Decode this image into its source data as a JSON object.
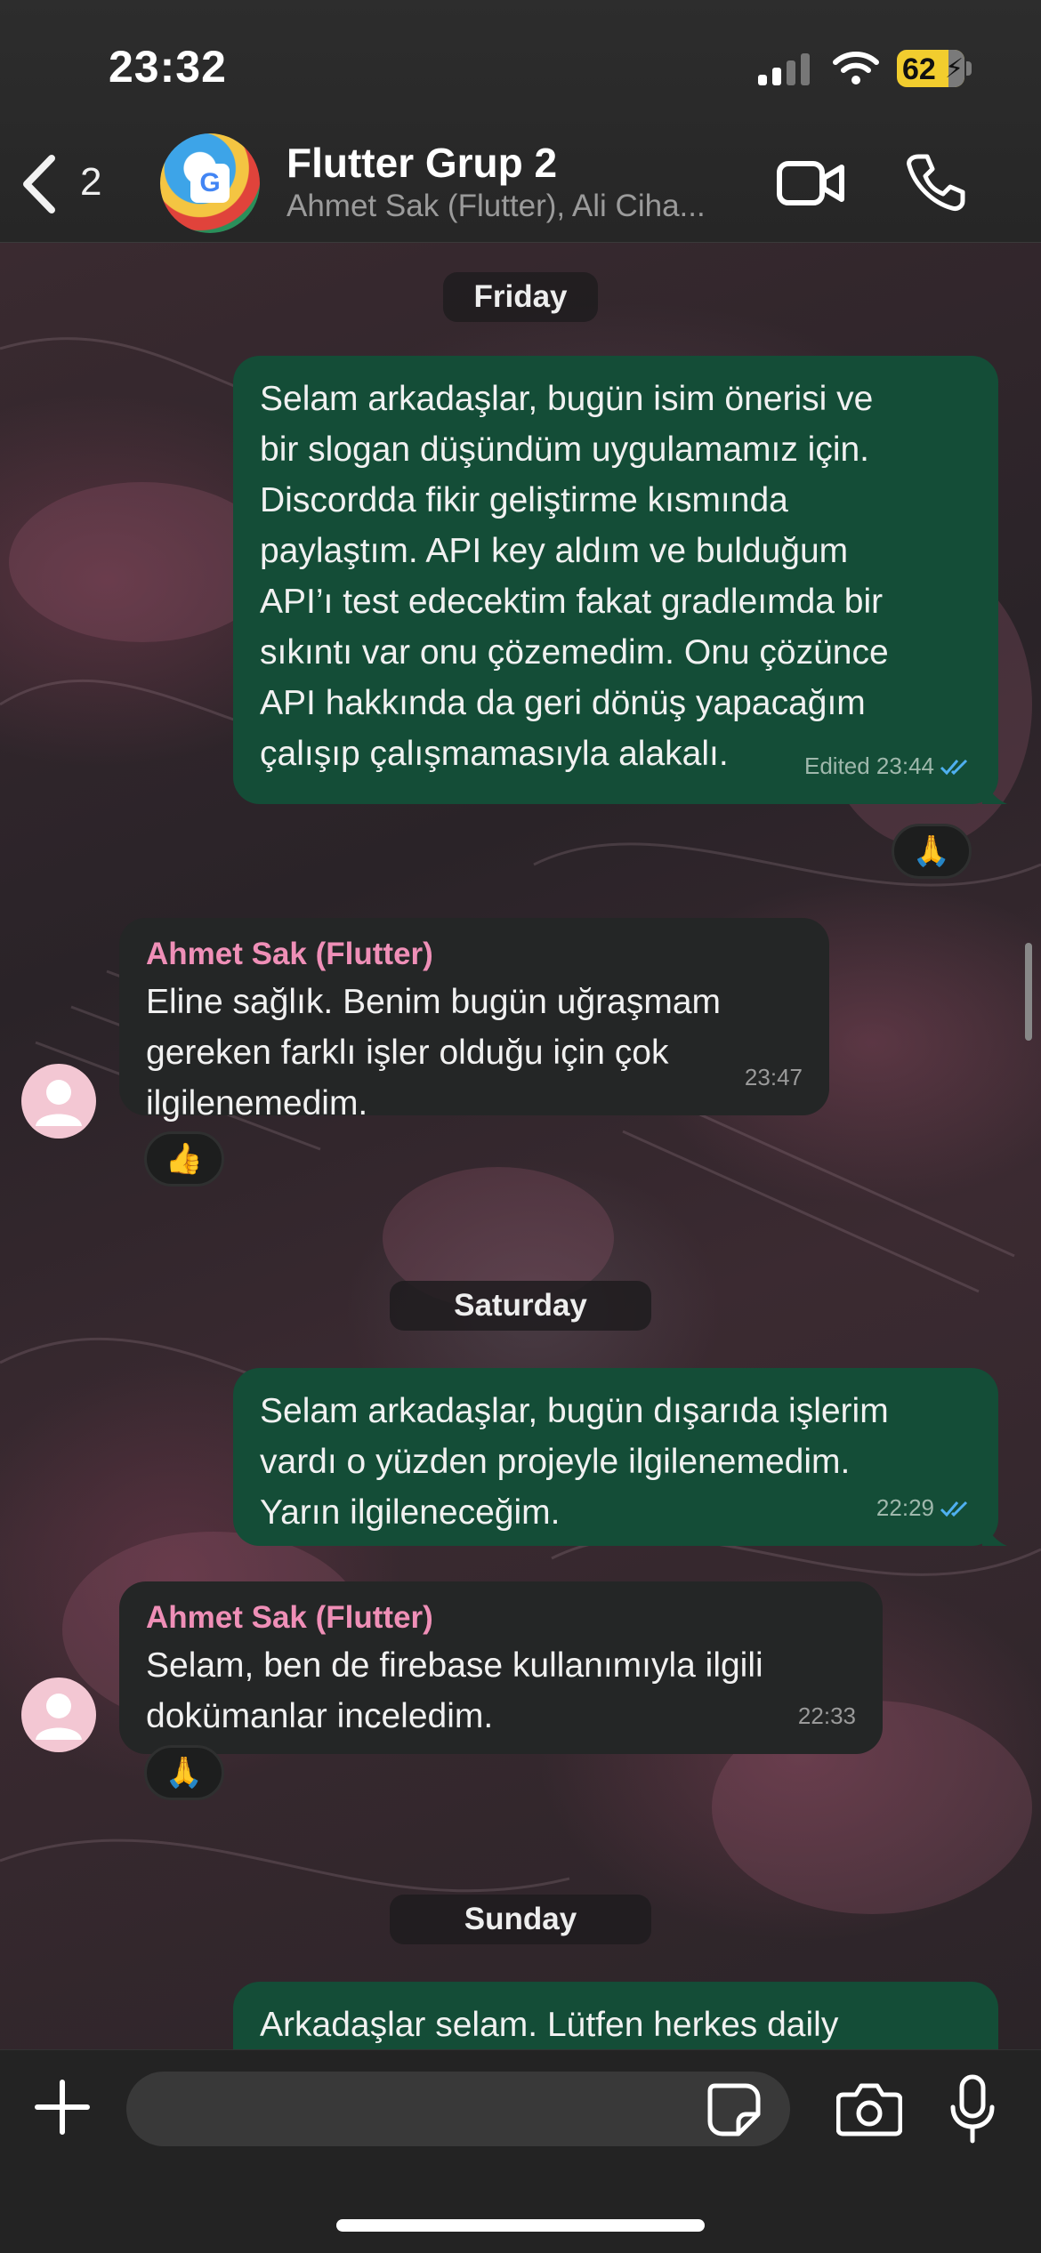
{
  "status_bar": {
    "time": "23:32",
    "battery": "62"
  },
  "header": {
    "back_count": "2",
    "title": "Flutter Grup 2",
    "subtitle": "Ahmet Sak (Flutter), Ali Ciha...",
    "video_icon": "video-call-icon",
    "phone_icon": "phone-call-icon"
  },
  "messages": [
    {
      "type": "date",
      "label": "Friday"
    },
    {
      "type": "outgoing",
      "text": "Selam arkadaşlar, bugün isim önerisi ve\nbir slogan düşündüm uygulamamız için.\nDiscordda fikir geliştirme kısmında\npaylaştım. API key aldım ve bulduğum\nAPI’ı test edecektim fakat gradleımda bir\nsıkıntı var onu çözemedim. Onu çözünce\nAPI hakkında da geri dönüş yapacağım\nçalışıp çalışmamasıyla alakalı.",
      "meta": "Edited 23:44",
      "reaction": "🙏",
      "read": true
    },
    {
      "type": "incoming",
      "sender": "Ahmet Sak (Flutter)",
      "text": "Eline sağlık. Benim bugün uğraşmam\ngereken farklı işler olduğu için çok\nilgilenemedim.",
      "meta": "23:47",
      "reaction": "👍"
    },
    {
      "type": "date",
      "label": "Saturday"
    },
    {
      "type": "outgoing",
      "text": "Selam arkadaşlar, bugün dışarıda işlerim\nvardı o yüzden projeyle ilgilenemedim.\nYarın ilgileneceğim.",
      "meta": "22:29",
      "read": true
    },
    {
      "type": "incoming",
      "sender": "Ahmet Sak (Flutter)",
      "text": "Selam, ben de firebase kullanımıyla ilgili\ndokümanlar inceledim.",
      "meta": "22:33",
      "reaction": "🙏"
    },
    {
      "type": "date",
      "label": "Sunday"
    },
    {
      "type": "outgoing",
      "text": "Arkadaşlar selam. Lütfen herkes daily"
    }
  ],
  "input_bar": {
    "placeholder": ""
  },
  "colors": {
    "outgoing_bubble": "#144d37",
    "incoming_bubble": "#242626",
    "sender_name": "#ef8fb7",
    "read_tick": "#4fb0f0"
  }
}
